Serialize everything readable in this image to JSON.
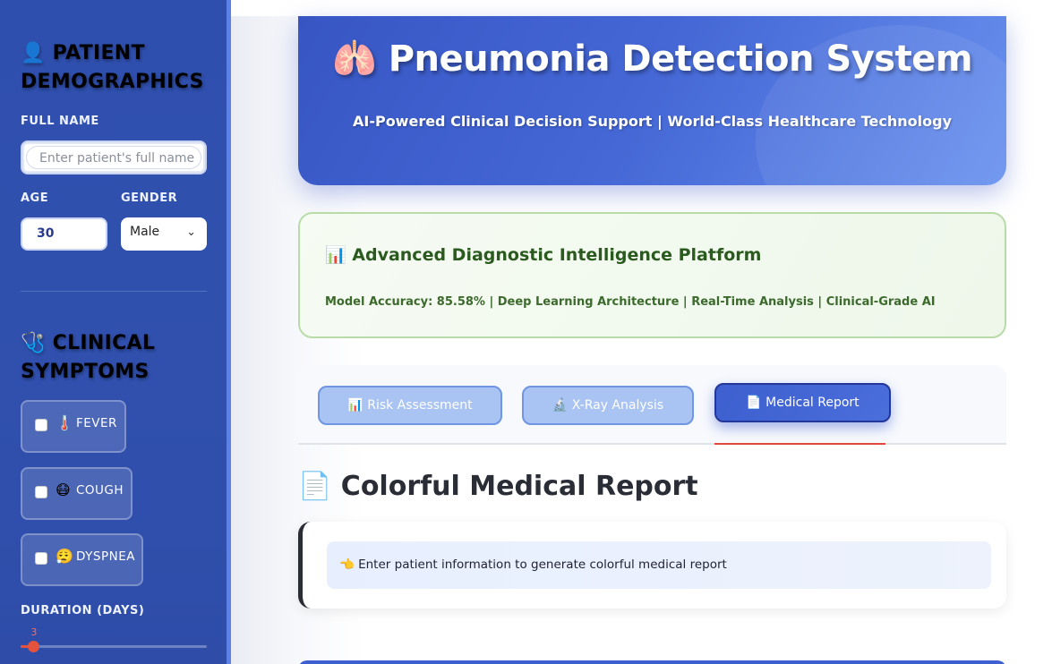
{
  "sidebar": {
    "demographics_heading": "👤 PATIENT DEMOGRAPHICS",
    "full_name_label": "FULL NAME",
    "full_name_placeholder": "Enter patient's full name",
    "age_label": "AGE",
    "age_value": "30",
    "gender_label": "GENDER",
    "gender_value": "Male",
    "symptoms_heading": "🩺 CLINICAL SYMPTOMS",
    "symptoms": [
      {
        "emoji": "🌡️",
        "label": "FEVER",
        "checked": false
      },
      {
        "emoji": "😷",
        "label": "COUGH",
        "checked": false
      },
      {
        "emoji": "😮‍💨",
        "label": "DYSPNEA",
        "checked": false
      }
    ],
    "duration_label": "DURATION (DAYS)",
    "duration_value": "3",
    "colors": {
      "background": "#3150ae",
      "slider_accent": "#e4533d"
    }
  },
  "header": {
    "title": "🫁 Pneumonia Detection System",
    "subtitle": "AI-Powered Clinical Decision Support | World-Class Healthcare Technology"
  },
  "info_card": {
    "title": "📊 Advanced Diagnostic Intelligence Platform",
    "subtitle": "Model Accuracy: 85.58% | Deep Learning Architecture | Real-Time Analysis | Clinical-Grade AI"
  },
  "tabs": [
    {
      "label": "📊 Risk Assessment",
      "active": false
    },
    {
      "label": "🔬 X-Ray Analysis",
      "active": false
    },
    {
      "label": "📄 Medical Report",
      "active": true
    }
  ],
  "report": {
    "title": "📄 Colorful Medical Report",
    "message": "👈 Enter patient information to generate colorful medical report"
  }
}
